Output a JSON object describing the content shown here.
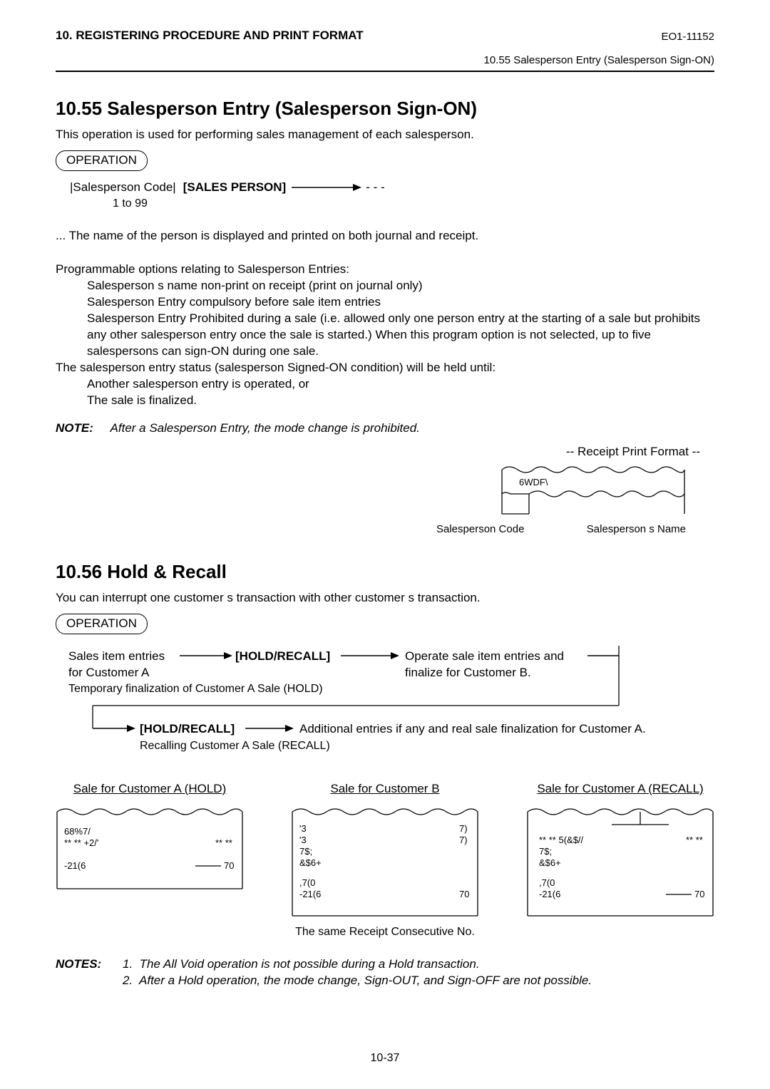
{
  "header": {
    "left": "10. REGISTERING PROCEDURE AND PRINT FORMAT",
    "right": "EO1-11152",
    "sub": "10.55 Salesperson Entry (Salesperson Sign-ON)"
  },
  "s1": {
    "title": "10.55  Salesperson Entry (Salesperson Sign-ON)",
    "intro": "This operation is used for performing sales management of each salesperson.",
    "op_label": "OPERATION",
    "code_label": "|Salesperson Code|",
    "sales_person": "[SALES PERSON]",
    "dashes": "- - -",
    "range": "1 to 99",
    "printed_line": "... The name of the person is displayed and printed on both journal and receipt.",
    "opts_intro": "Programmable options relating to Salesperson Entries:",
    "opt1": "Salesperson s name non-print on receipt (print on journal only)",
    "opt2": "Salesperson Entry compulsory before sale item entries",
    "opt3": "Salesperson Entry Prohibited during a sale (i.e. allowed only one person entry at the starting of a sale but prohibits any other salesperson entry once the sale is started.)  When this program option is not selected, up to five salespersons can sign-ON during one sale.",
    "held_intro": "The salesperson entry status (salesperson Signed-ON condition) will be held until:",
    "held1": "Another salesperson entry is operated, or",
    "held2": "The sale is finalized.",
    "note_label": "NOTE:",
    "note_body": "After a Salesperson Entry, the mode change is prohibited.",
    "rpf": "-- Receipt Print Format --",
    "receipt_text": "6WDF\\",
    "cap_left": "Salesperson Code",
    "cap_right": "Salesperson s Name"
  },
  "s2": {
    "title": "10.56  Hold & Recall",
    "intro": "You can interrupt one customer s transaction with other customer s transaction.",
    "op_label": "OPERATION",
    "flow": {
      "a1": "Sales item entries",
      "a2": "for Customer A",
      "hr": "[HOLD/RECALL]",
      "b1": "Operate sale item entries and",
      "b2": "finalize for Customer B.",
      "note_a": "Temporary finalization of Customer A Sale (HOLD)",
      "hr2": "[HOLD/RECALL]",
      "c": "Additional entries if any and real sale finalization for Customer A.",
      "note_b": "Recalling Customer A Sale (RECALL)"
    },
    "captions": {
      "a": "Sale for Customer A (HOLD)",
      "b": "Sale for Customer B",
      "c": "Sale for Customer A (RECALL)"
    },
    "recA": {
      "l1a": "68%7/",
      "l2a": "** ** +2/'",
      "l2b": "** **",
      "l3a": "-21(6",
      "l3b": "70"
    },
    "recB": {
      "l1a": "'3",
      "l1b": "7)",
      "l2a": "'3",
      "l2b": "7)",
      "l3a": "7$;",
      "l4a": "&$6+",
      "l5a": ",7(0",
      "l6a": "-21(6",
      "l6b": "70"
    },
    "recC": {
      "l1a": "** ** 5(&$//",
      "l1b": "** **",
      "l2a": "7$;",
      "l3a": "&$6+",
      "l4a": ",7(0",
      "l5a": "-21(6",
      "l5b": "70"
    },
    "consec": "The same Receipt Consecutive No.",
    "notes_label": "NOTES:",
    "note1_num": "1.",
    "note1": "The All Void operation is not possible during a Hold transaction.",
    "note2_num": "2.",
    "note2": "After a Hold operation, the mode change, Sign-OUT, and Sign-OFF are not possible."
  },
  "page_no": "10-37"
}
